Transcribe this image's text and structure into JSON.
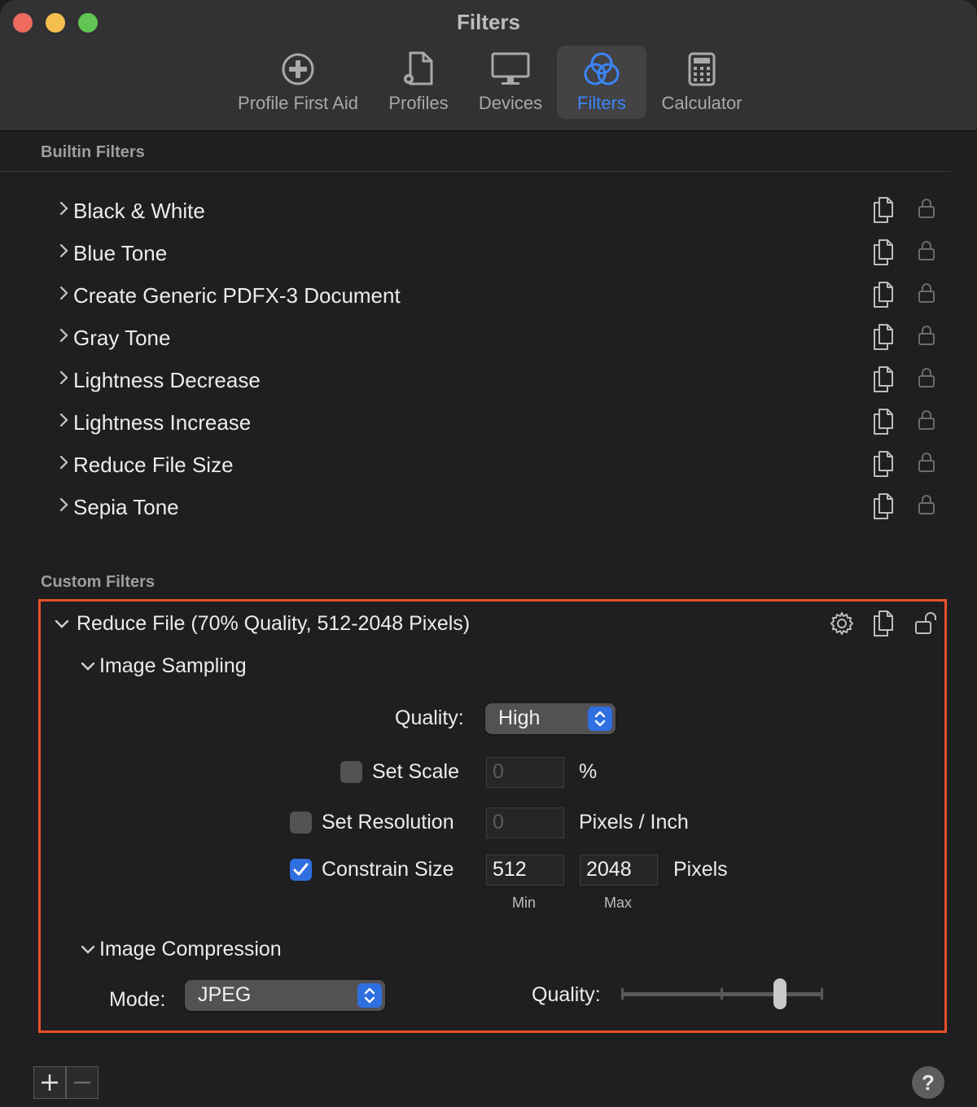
{
  "window": {
    "title": "Filters"
  },
  "toolbar": {
    "items": [
      {
        "label": "Profile First Aid",
        "icon": "plus-circle-icon",
        "selected": false
      },
      {
        "label": "Profiles",
        "icon": "document-gear-icon",
        "selected": false
      },
      {
        "label": "Devices",
        "icon": "monitor-icon",
        "selected": false
      },
      {
        "label": "Filters",
        "icon": "three-circles-icon",
        "selected": true
      },
      {
        "label": "Calculator",
        "icon": "calculator-icon",
        "selected": false
      }
    ],
    "accent_color": "#3a86f7"
  },
  "builtin": {
    "header": "Builtin Filters",
    "filters": [
      "Black & White",
      "Blue Tone",
      "Create Generic PDFX-3 Document",
      "Gray Tone",
      "Lightness Decrease",
      "Lightness Increase",
      "Reduce File Size",
      "Sepia Tone"
    ]
  },
  "custom": {
    "header": "Custom Filters",
    "filter_name": "Reduce File (70% Quality, 512-2048 Pixels)",
    "highlight_color": "#e8512f",
    "image_sampling": {
      "title": "Image Sampling",
      "quality_label": "Quality:",
      "quality_value": "High",
      "set_scale": {
        "label": "Set Scale",
        "checked": false,
        "value": "0",
        "unit": "%"
      },
      "set_resolution": {
        "label": "Set Resolution",
        "checked": false,
        "value": "0",
        "unit": "Pixels / Inch"
      },
      "constrain_size": {
        "label": "Constrain Size",
        "checked": true,
        "min": "512",
        "max": "2048",
        "unit": "Pixels",
        "min_label": "Min",
        "max_label": "Max"
      }
    },
    "image_compression": {
      "title": "Image Compression",
      "mode_label": "Mode:",
      "mode_value": "JPEG",
      "quality_label": "Quality:",
      "quality_fraction": 0.79
    }
  },
  "footer": {
    "add": "+",
    "remove": "−",
    "help": "?"
  }
}
